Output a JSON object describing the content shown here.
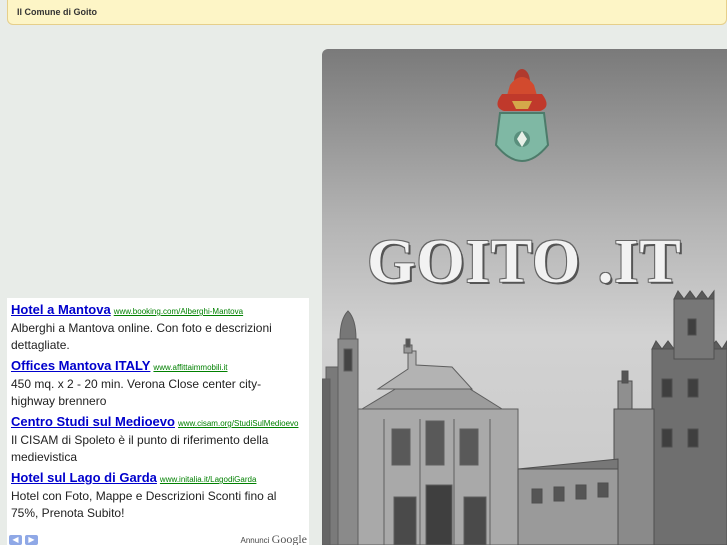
{
  "header": {
    "title": "Il Comune di Goito"
  },
  "hero": {
    "site_title": "GOITO .IT"
  },
  "ads": {
    "items": [
      {
        "title": "Hotel a Mantova",
        "url": "www.booking.com/Alberghi-Mantova",
        "desc": "Alberghi a Mantova online. Con foto e descrizioni dettagliate."
      },
      {
        "title": "Offices Mantova ITALY",
        "url": "www.affittaimmobili.it",
        "desc": "450 mq. x 2 - 20 min. Verona Close center city- highway brennero"
      },
      {
        "title": "Centro Studi sul Medioevo",
        "url": "www.cisam.org/StudiSulMedioevo",
        "desc": "Il CISAM di Spoleto è il punto di riferimento della medievistica"
      },
      {
        "title": "Hotel sul Lago di Garda",
        "url": "www.initalia.it/LagodiGarda",
        "desc": "Hotel con Foto, Mappe e Descrizioni Sconti fino al 75%, Prenota Subito!"
      }
    ],
    "footer_label": "Annunci",
    "footer_brand": "Google",
    "prev_icon": "chevron-left-icon",
    "next_icon": "chevron-right-icon"
  }
}
